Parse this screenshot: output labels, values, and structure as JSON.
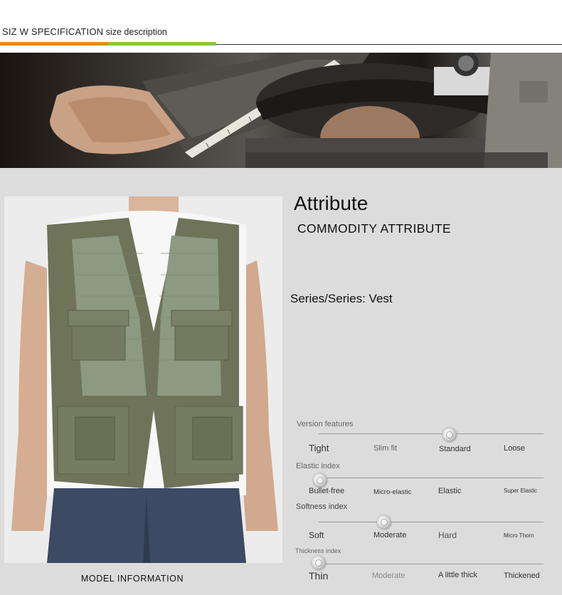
{
  "header": {
    "title_main": "SIZ W SPECIFICATION",
    "title_sub": " size description",
    "accent_colors": [
      "#e08a24",
      "#8cc63e"
    ]
  },
  "banner": {
    "image": "tailor-measuring-tape-photo"
  },
  "product_photo": {
    "image": "model-wearing-green-mesh-vest"
  },
  "model_info_label": "MODEL INFORMATION",
  "attribute": {
    "title": "Attribute",
    "subtitle": "COMMODITY ATTRIBUTE",
    "series": "Series/Series: Vest"
  },
  "indices": [
    {
      "label": "Version features",
      "options": [
        "Tight",
        "Slim fit",
        "Standard",
        "Loose"
      ],
      "selected": 2
    },
    {
      "label": "Elastic index",
      "options": [
        "Bullet-free",
        "Micro-elastic",
        "Elastic",
        "Super Elastic"
      ],
      "selected": 0
    },
    {
      "label": "Softness index",
      "options": [
        "Soft",
        "Moderate",
        "Hard",
        "Micro Thorn"
      ],
      "selected": 1
    },
    {
      "label": "Thickness index",
      "options": [
        "Thin",
        "Moderate",
        "A little thick",
        "Thickened"
      ],
      "selected": 0
    }
  ]
}
